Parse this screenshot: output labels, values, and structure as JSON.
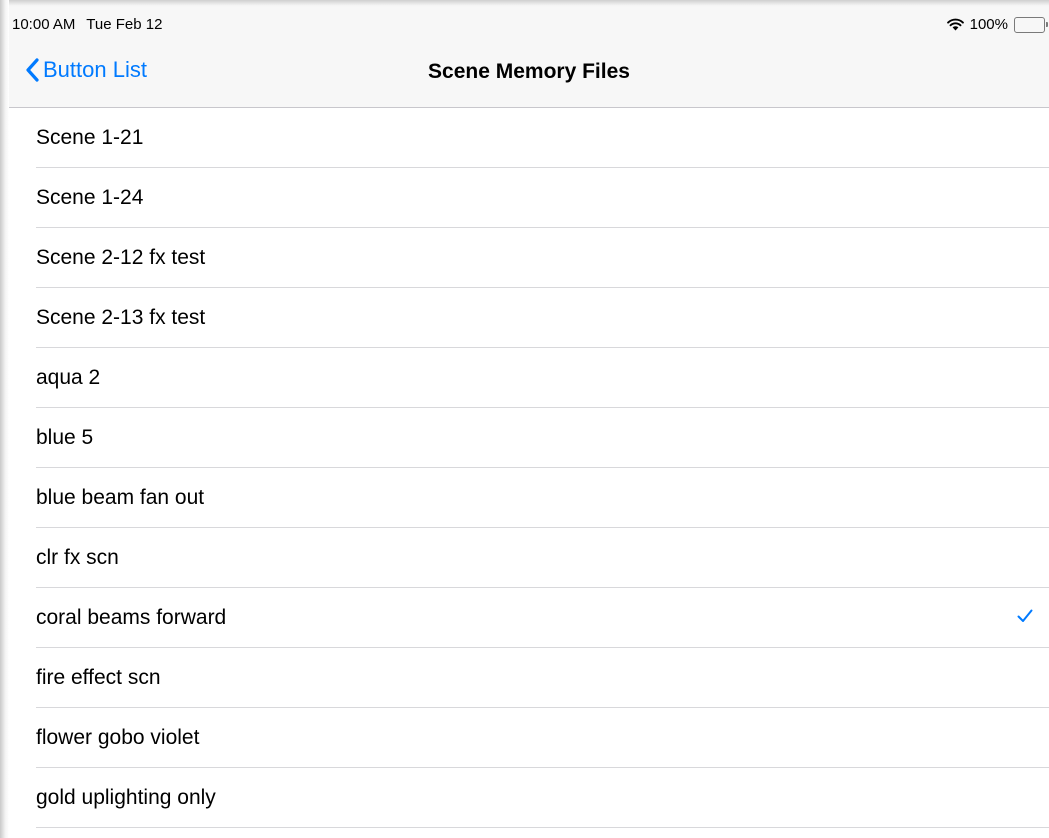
{
  "status_bar": {
    "time": "10:00 AM",
    "date": "Tue Feb 12",
    "battery_percent_label": "100%",
    "battery_level": 1.0,
    "wifi_icon": "wifi-icon"
  },
  "nav": {
    "back_label": "Button List",
    "back_icon": "chevron-left-icon",
    "title": "Scene Memory Files"
  },
  "colors": {
    "accent": "#007aff",
    "battery": "#4cd964",
    "bar_background": "#f7f7f7",
    "separator": "#d8d8db"
  },
  "list": {
    "selected_index": 8,
    "selected_icon": "checkmark-icon",
    "items": [
      {
        "label": "Scene 1-21"
      },
      {
        "label": "Scene 1-24"
      },
      {
        "label": "Scene 2-12 fx test"
      },
      {
        "label": "Scene 2-13 fx test"
      },
      {
        "label": "aqua 2"
      },
      {
        "label": "blue 5"
      },
      {
        "label": "blue beam fan out"
      },
      {
        "label": "clr fx scn"
      },
      {
        "label": "coral beams forward"
      },
      {
        "label": "fire effect scn"
      },
      {
        "label": "flower gobo violet"
      },
      {
        "label": "gold uplighting only"
      }
    ]
  }
}
